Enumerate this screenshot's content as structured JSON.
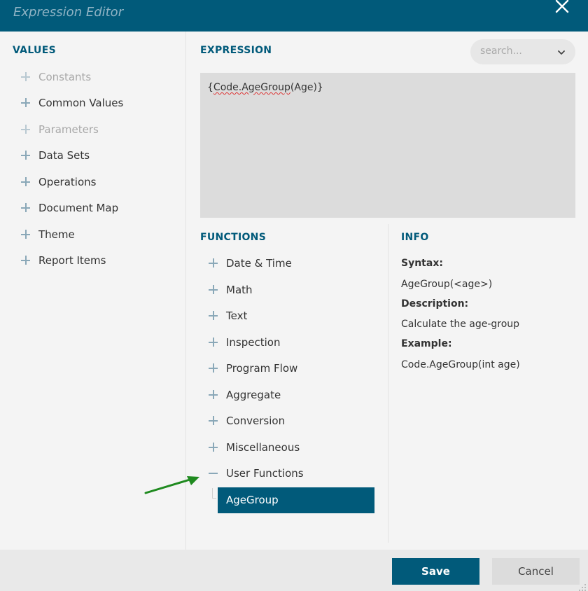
{
  "window": {
    "title": "Expression Editor",
    "close_icon": "close-icon"
  },
  "values": {
    "title": "VALUES",
    "items": [
      {
        "label": "Constants",
        "disabled": true
      },
      {
        "label": "Common Values",
        "disabled": false
      },
      {
        "label": "Parameters",
        "disabled": true
      },
      {
        "label": "Data Sets",
        "disabled": false
      },
      {
        "label": "Operations",
        "disabled": false
      },
      {
        "label": "Document Map",
        "disabled": false
      },
      {
        "label": "Theme",
        "disabled": false
      },
      {
        "label": "Report Items",
        "disabled": false
      }
    ]
  },
  "expression": {
    "title": "EXPRESSION",
    "open_brace": "{",
    "misspelled": "Code.AgeGroup",
    "rest": "(Age)}"
  },
  "search": {
    "placeholder": "search..."
  },
  "functions": {
    "title": "FUNCTIONS",
    "items": [
      {
        "label": "Date & Time"
      },
      {
        "label": "Math"
      },
      {
        "label": "Text"
      },
      {
        "label": "Inspection"
      },
      {
        "label": "Program Flow"
      },
      {
        "label": "Aggregate"
      },
      {
        "label": "Conversion"
      },
      {
        "label": "Miscellaneous"
      },
      {
        "label": "User Functions",
        "expanded": true
      }
    ],
    "selected": "AgeGroup"
  },
  "info": {
    "title": "INFO",
    "syntax_label": "Syntax:",
    "syntax_value": "AgeGroup(<age>)",
    "description_label": "Description:",
    "description_value": "Calculate the age-group",
    "example_label": "Example:",
    "example_value": "Code.AgeGroup(int age)"
  },
  "footer": {
    "save_label": "Save",
    "cancel_label": "Cancel"
  },
  "colors": {
    "accent": "#015a7a",
    "annotation_arrow": "#1f8a1f"
  }
}
